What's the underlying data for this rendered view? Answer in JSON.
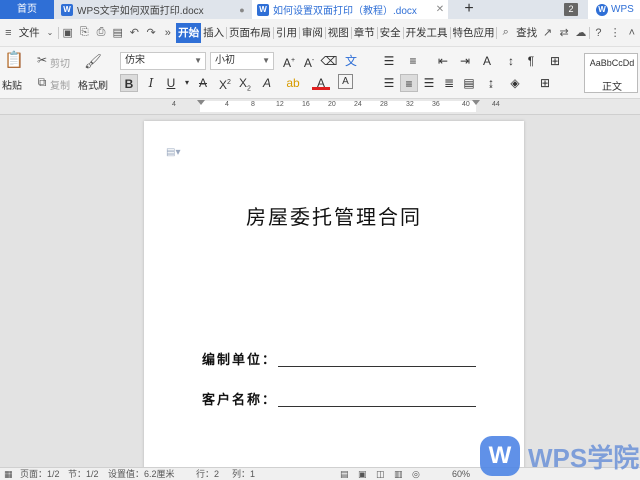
{
  "tabs": {
    "home": "首页",
    "doc1_title": "WPS文字如何双面打印.docx",
    "doc2_title": "如何设置双面打印（教程）.docx",
    "new_tab": "+",
    "window_count": "2",
    "brand": "WPS"
  },
  "menu": {
    "file": "文件",
    "items": [
      "开始",
      "插入",
      "页面布局",
      "引用",
      "审阅",
      "视图",
      "章节",
      "安全",
      "开发工具",
      "特色应用"
    ],
    "active": "开始",
    "search": "查找"
  },
  "ribbon": {
    "paste": "粘贴",
    "cut": "剪切",
    "copy": "复制",
    "format_painter": "格式刷",
    "font_name": "仿宋",
    "font_size": "小初",
    "style_preview": "AaBbCcDd",
    "style_name": "正文"
  },
  "ruler": {
    "ticks": [
      "4",
      "4",
      "8",
      "12",
      "16",
      "20",
      "24",
      "28",
      "32",
      "36",
      "40",
      "44"
    ]
  },
  "document": {
    "title": "房屋委托管理合同",
    "field1_label": "编制单位：",
    "field2_label": "客户名称："
  },
  "status": {
    "page": "页面：1/2",
    "section": "节：1/2",
    "settings": "设置值：6.2厘米",
    "row": "行：2",
    "col": "列：1",
    "zoom": "60%"
  },
  "watermark": {
    "text": "WPS学院"
  },
  "colors": {
    "accent": "#2f6fd6",
    "watermark": "#6d93d8"
  }
}
